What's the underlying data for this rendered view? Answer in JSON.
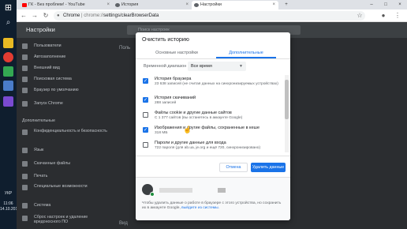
{
  "taskbar": {
    "lang": "УКР",
    "time": "11:06",
    "date": "14.10.2019"
  },
  "tabs": [
    {
      "label": "ГК - Без проблем! - YouTube"
    },
    {
      "label": "История"
    },
    {
      "label": "Настройки"
    }
  ],
  "address": {
    "prefix": "Chrome",
    "host": "chrome://",
    "path": "settings/clearBrowserData"
  },
  "settings": {
    "title": "Настройки",
    "search_placeholder": "Поиск настроек",
    "sidebar": [
      "Пользователи",
      "Автозаполнение",
      "Внешний вид",
      "Поисковая система",
      "Браузер по умолчанию",
      "Запуск Chrome",
      "Дополнительные",
      "Конфиденциальность и безопасность",
      "Язык",
      "Скачанные файлы",
      "Печать",
      "Специальные возможности",
      "Система",
      "Сброс настроек и удаление вредоносного ПО"
    ],
    "main_fragments": [
      "Поль",
      "Вид"
    ]
  },
  "dialog": {
    "title": "Очистить историю",
    "tab_basic": "Основные настройки",
    "tab_advanced": "Дополнительные",
    "range_label": "Временной диапазон",
    "range_value": "Все время",
    "options": [
      {
        "title": "История браузера",
        "sub": "23 638 записей (не считая данных на синхронизируемых устройствах)",
        "checked": true
      },
      {
        "title": "История скачиваний",
        "sub": "288 записей",
        "checked": true
      },
      {
        "title": "Файлы cookie и другие данные сайтов",
        "sub": "С 1 377 сайтов (вы останетесь в аккаунте Google)",
        "checked": false
      },
      {
        "title": "Изображения и другие файлы, сохраненные в кеше",
        "sub": "318 МБ",
        "checked": true
      },
      {
        "title": "Пароли и другие данные для входа",
        "sub": "722 пароля (для ab.ua, je.org и ещё 720, синхронизировано)",
        "checked": false
      }
    ],
    "cancel": "Отмена",
    "delete": "Удалить данные",
    "sync_note": "Чтобы удалить данные о работе в браузере с этого устройства, но сохранить их в аккаунте Google,",
    "sync_link": "выйдите из системы."
  }
}
